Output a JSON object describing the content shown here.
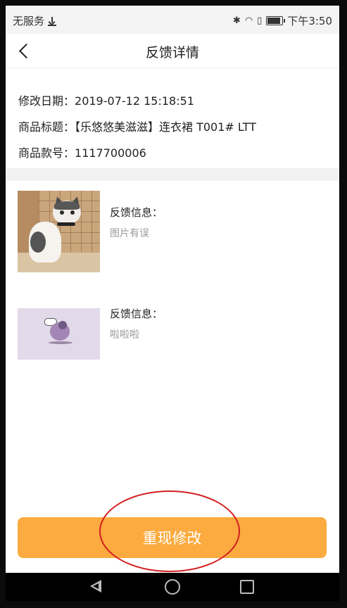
{
  "status_bar": {
    "carrier": "无服务",
    "time": "下午3:50",
    "battery_level": 0.9
  },
  "nav": {
    "title": "反馈详情"
  },
  "info": {
    "modify_date_label": "修改日期：",
    "modify_date_value": "2019-07-12 15:18:51",
    "product_title_label": "商品标题：",
    "product_title_value": "【乐悠悠美滋滋】连衣裙 T001# LTT",
    "product_code_label": "商品款号：",
    "product_code_value": "1117700006"
  },
  "feedback_items": [
    {
      "label": "反馈信息：",
      "text": "图片有误",
      "image": "cat-photo"
    },
    {
      "label": "反馈信息：",
      "text": "啦啦啦",
      "image": "sticker-photo"
    }
  ],
  "action": {
    "label": "重现修改",
    "color": "#fbab3f"
  },
  "annotation_color": "#d41f1f"
}
